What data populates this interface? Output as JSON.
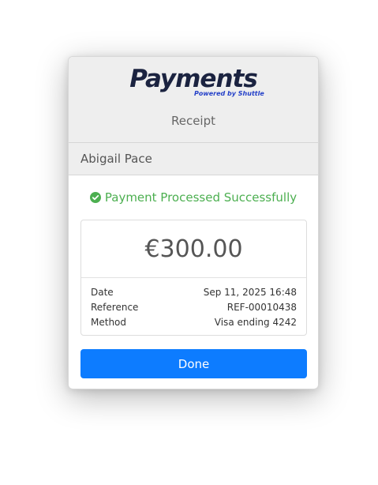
{
  "brand": {
    "name": "Payments",
    "tagline": "Powered by Shuttle"
  },
  "header": {
    "title": "Receipt"
  },
  "customer": {
    "name": "Abigail Pace"
  },
  "status": {
    "message": "Payment Processed Successfully",
    "icon": "check-circle-icon",
    "color": "#4caf50"
  },
  "amount": "€300.00",
  "details": [
    {
      "label": "Date",
      "value": "Sep 11, 2025 16:48"
    },
    {
      "label": "Reference",
      "value": "REF-00010438"
    },
    {
      "label": "Method",
      "value": "Visa ending 4242"
    }
  ],
  "actions": {
    "done_label": "Done"
  },
  "colors": {
    "accent": "#0d7cff",
    "brand": "#1b2340",
    "success": "#4caf50"
  }
}
